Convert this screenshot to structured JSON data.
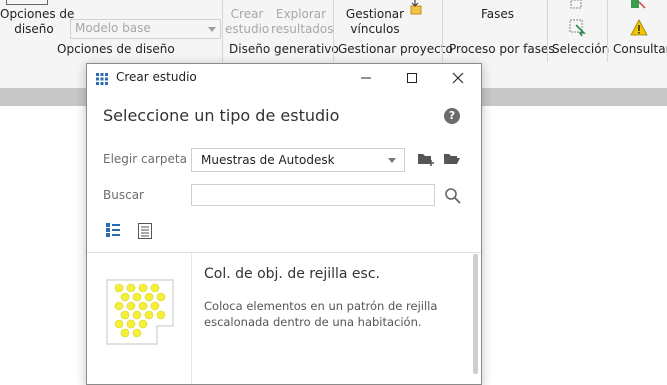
{
  "ribbon": {
    "design_options_label": "Opciones de diseño",
    "design_options_line1": "Opciones de",
    "design_options_line2": "diseño",
    "model_dropdown": "Modelo base",
    "panel_design_options": "Opciones de diseño",
    "create_study_line1": "Crear",
    "create_study_line2": "estudio",
    "explore_results_line1": "Explorar",
    "explore_results_line2": "resultados",
    "panel_generative": "Diseño generativo",
    "manage_links_line1": "Gestionar",
    "manage_links_line2": "vínculos",
    "panel_manage_project": "Gestionar proyecto",
    "phases_label": "Fases",
    "panel_phases": "Proceso por fases",
    "panel_selection": "Selección",
    "panel_query": "Consultar"
  },
  "dialog": {
    "title": "Crear estudio",
    "heading": "Seleccione un tipo de estudio",
    "folder_label": "Elegir carpeta",
    "folder_value": "Muestras de Autodesk",
    "search_label": "Buscar",
    "search_value": "",
    "study": {
      "title": "Col. de obj. de rejilla esc.",
      "description": "Coloca elementos en un patrón de rejilla escalonada dentro de una habitación."
    }
  },
  "colors": {
    "accent_blue": "#2b6cb0",
    "grid_yellow": "#f4f03a"
  }
}
